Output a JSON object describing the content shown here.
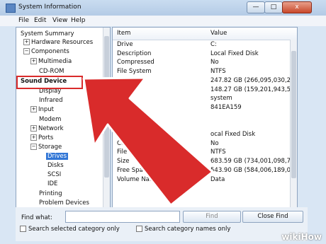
{
  "window": {
    "title": "System Information",
    "min_glyph": "—",
    "max_glyph": "□",
    "close_glyph": "x"
  },
  "menu": {
    "file": "File",
    "edit": "Edit",
    "view": "View",
    "help": "Help"
  },
  "tree": {
    "system_summary": "System Summary",
    "hardware_resources": "Hardware Resources",
    "components": "Components",
    "multimedia": "Multimedia",
    "cdrom": "CD-ROM",
    "sound_device": "Sound Device",
    "display": "Display",
    "infrared": "Infrared",
    "input": "Input",
    "modem": "Modem",
    "network": "Network",
    "ports": "Ports",
    "storage": "Storage",
    "drives": "Drives",
    "disks": "Disks",
    "scsi": "SCSI",
    "ide": "IDE",
    "printing": "Printing",
    "problem_devices": "Problem Devices"
  },
  "list": {
    "col_item": "Item",
    "col_value": "Value",
    "rows": [
      {
        "item": "Drive",
        "value": "C:"
      },
      {
        "item": "Description",
        "value": "Local Fixed Disk"
      },
      {
        "item": "Compressed",
        "value": "No"
      },
      {
        "item": "File System",
        "value": "NTFS"
      },
      {
        "item": "",
        "value": "247.82 GB (266,095,030,272 b"
      },
      {
        "item": "",
        "value": "148.27 GB (159,201,943,552 b"
      },
      {
        "item": "",
        "value": "system"
      },
      {
        "item": "",
        "value": "841EA159"
      },
      {
        "item": "",
        "value": ""
      },
      {
        "item": "Drive",
        "value": ""
      },
      {
        "item": "Description",
        "value": "ocal Fixed Disk"
      },
      {
        "item": "Compressed",
        "value": "No"
      },
      {
        "item": "File System",
        "value": "NTFS"
      },
      {
        "item": "Size",
        "value": "683.59 GB (734,001,098,752 b"
      },
      {
        "item": "Free Space",
        "value": "543.90 GB (584,006,189,056 b"
      },
      {
        "item": "Volume Name",
        "value": "Data"
      }
    ]
  },
  "find": {
    "label": "Find what:",
    "input_value": "",
    "find_button": "Find",
    "close_button": "Close Find",
    "check1": "Search selected category only",
    "check2": "Search category names only"
  },
  "watermark": "wikiHow",
  "colors": {
    "arrow": "#d92b2b",
    "selection": "#3176d6"
  }
}
